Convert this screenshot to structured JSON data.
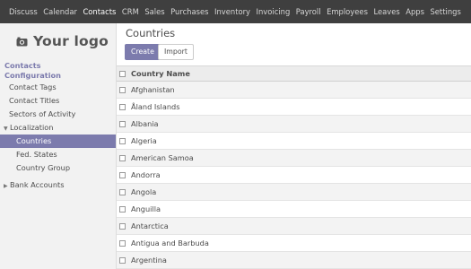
{
  "topbar": {
    "items": [
      "Discuss",
      "Calendar",
      "Contacts",
      "CRM",
      "Sales",
      "Purchases",
      "Inventory",
      "Invoicing",
      "Payroll",
      "Employees",
      "Leaves",
      "Apps",
      "Settings"
    ],
    "active": "Contacts"
  },
  "sidebar": {
    "logo_text": "Your logo",
    "section_line1": "Contacts",
    "section_line2": "Configuration",
    "items": {
      "contact_tags": "Contact Tags",
      "contact_titles": "Contact Titles",
      "sectors": "Sectors of Activity",
      "localization": "Localization",
      "countries": "Countries",
      "fed_states": "Fed. States",
      "country_group": "Country Group",
      "bank_accounts": "Bank Accounts"
    }
  },
  "main": {
    "breadcrumb": "Countries",
    "create_label": "Create",
    "import_label": "Import",
    "table": {
      "header": "Country Name",
      "rows": [
        "Afghanistan",
        "Åland Islands",
        "Albania",
        "Algeria",
        "American Samoa",
        "Andorra",
        "Angola",
        "Anguilla",
        "Antarctica",
        "Antigua and Barbuda",
        "Argentina"
      ]
    }
  },
  "colors": {
    "accent": "#7c7bad",
    "topbar": "#3f3f3f"
  }
}
